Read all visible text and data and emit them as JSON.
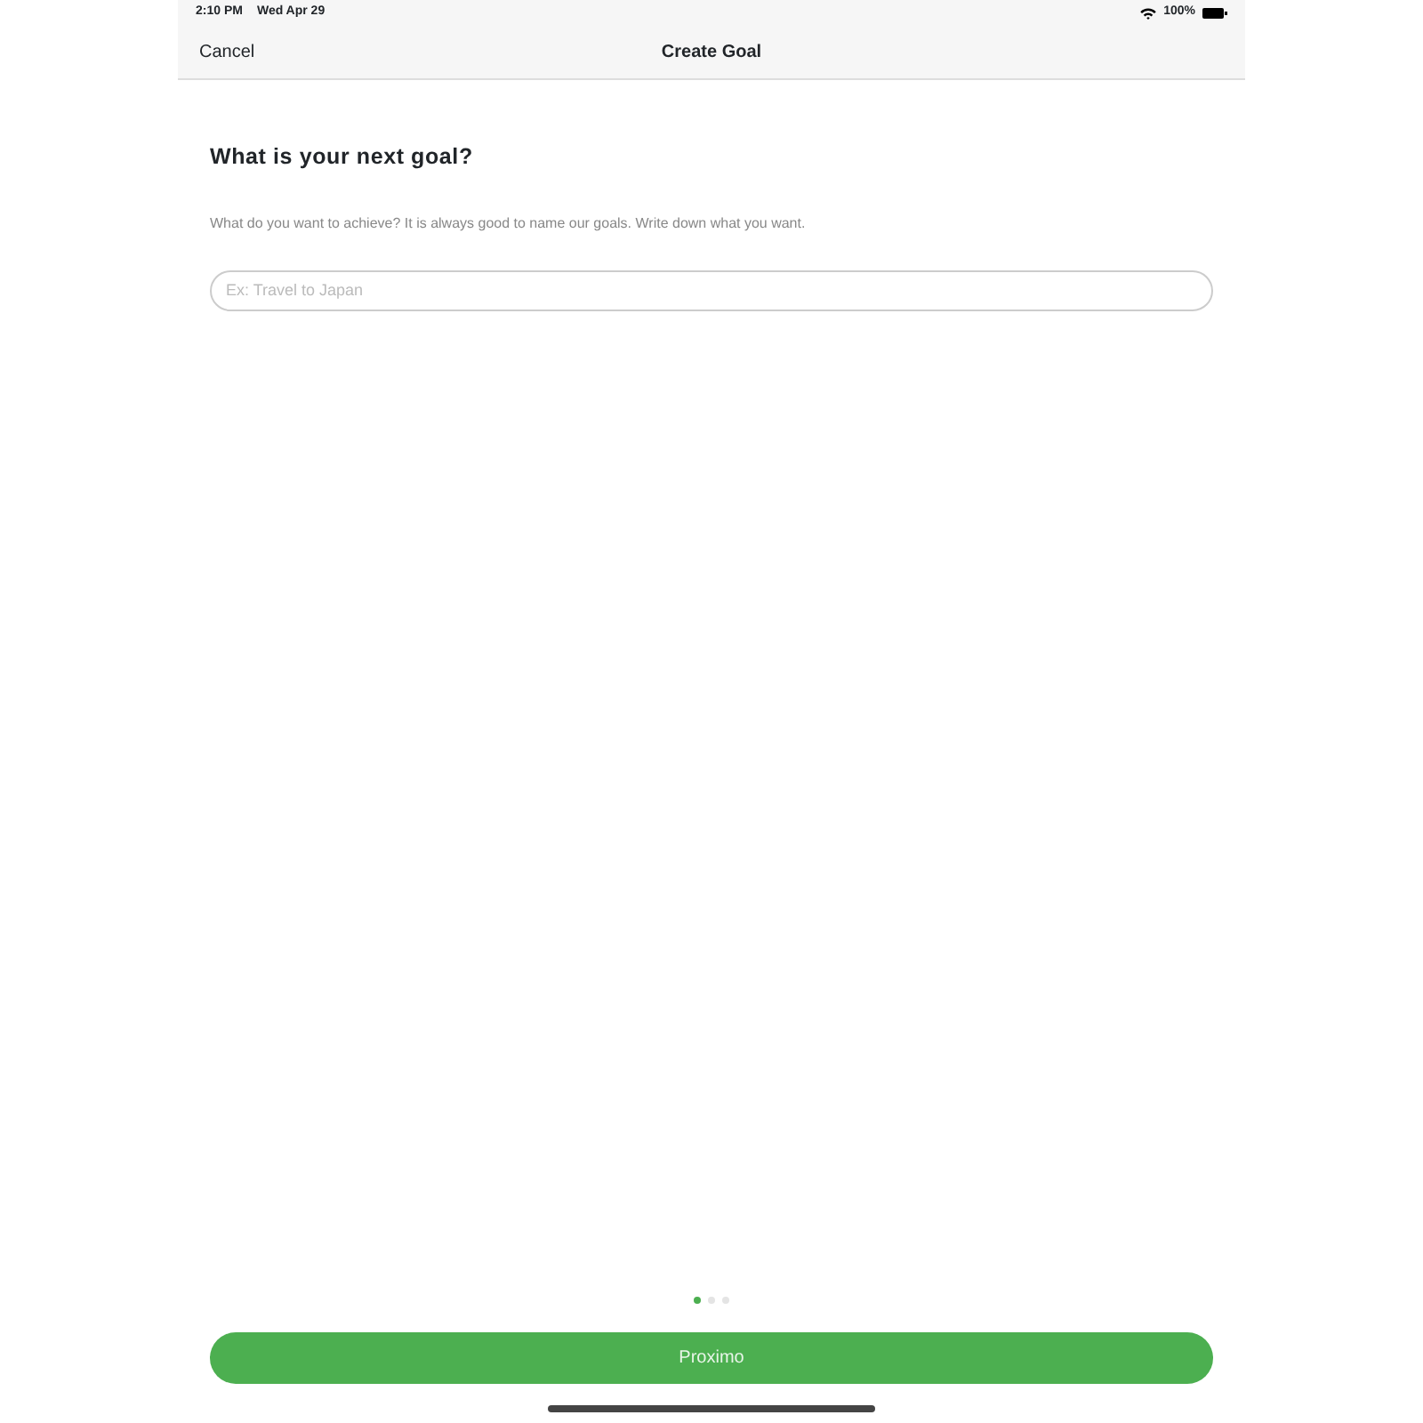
{
  "status_bar": {
    "time": "2:10 PM",
    "date": "Wed Apr 29",
    "battery": "100%"
  },
  "nav_bar": {
    "cancel": "Cancel",
    "title": "Create Goal"
  },
  "heading": "What is your next goal?",
  "description": "What do you want to achieve? It is always good to name our goals. Write down what you want.",
  "goal_field": {
    "placeholder": "Ex: Travel to Japan"
  },
  "page_dots": [
    {
      "selected": true
    },
    {
      "selected": false
    },
    {
      "selected": false
    }
  ],
  "next_button": "Proximo"
}
